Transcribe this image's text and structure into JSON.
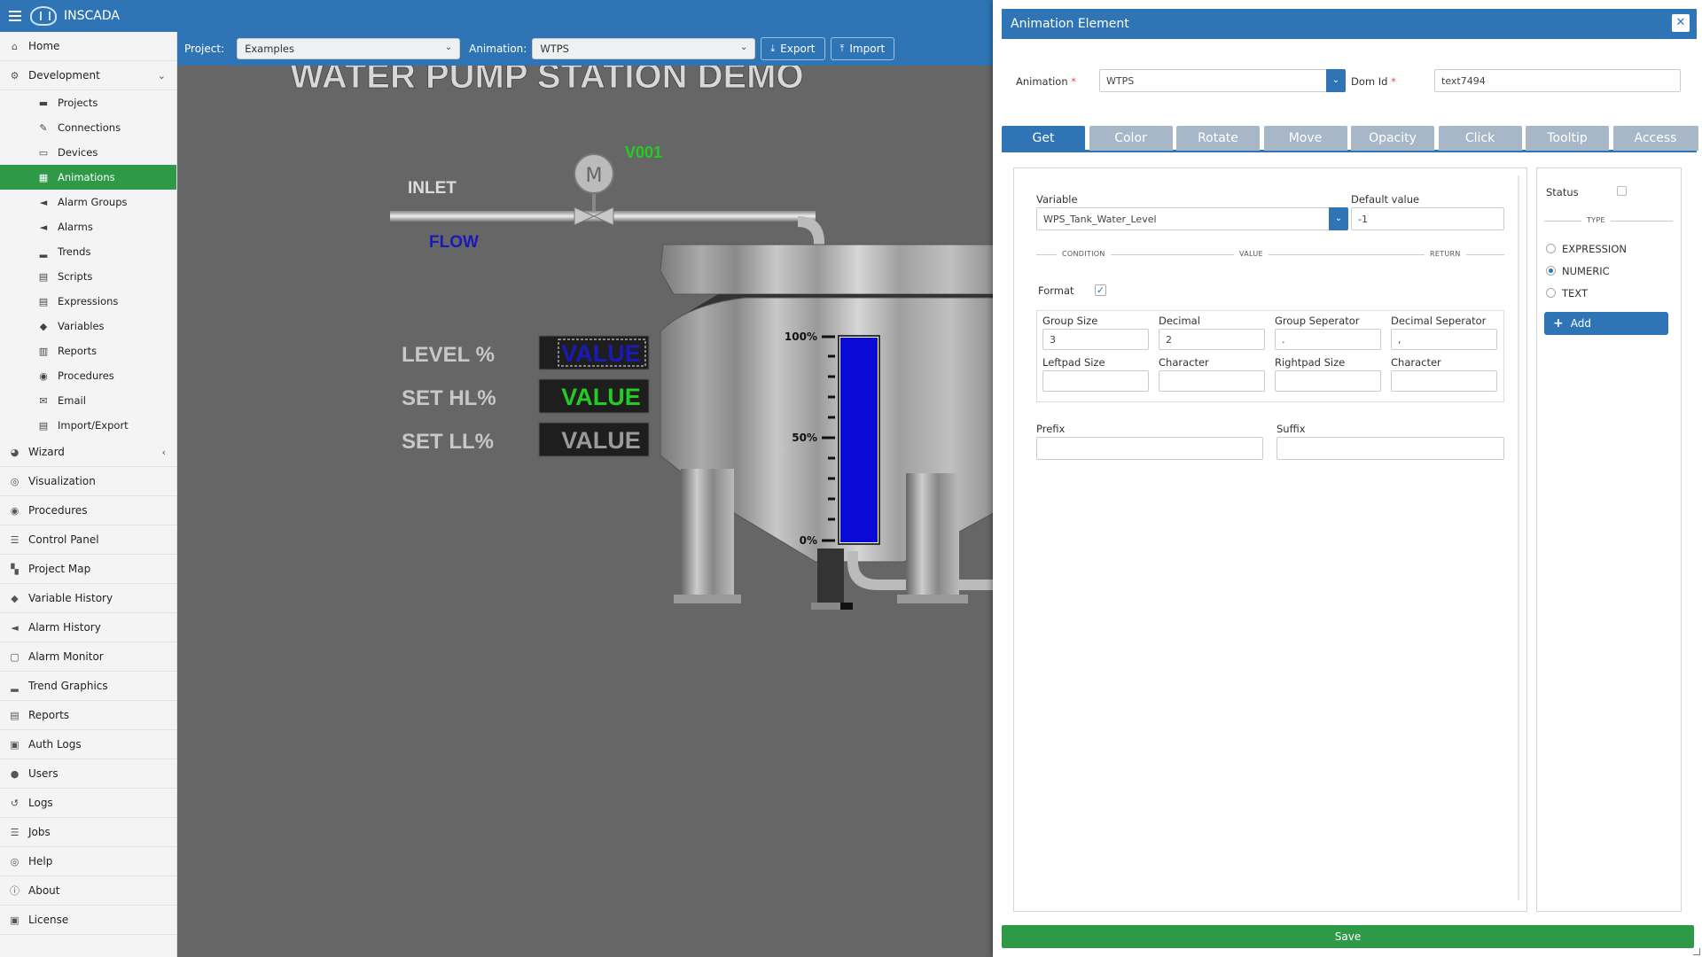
{
  "app": {
    "brand": "INSCADA"
  },
  "sidebar": {
    "items": [
      {
        "label": "Home",
        "icon": "home-icon",
        "glyph": "⌂",
        "type": "main"
      },
      {
        "label": "Development",
        "icon": "gear-icon",
        "glyph": "⚙",
        "type": "main",
        "chevron": "⌄"
      },
      {
        "label": "Projects",
        "icon": "folder-icon",
        "glyph": "▬",
        "type": "sub"
      },
      {
        "label": "Connections",
        "icon": "plug-icon",
        "glyph": "✎",
        "type": "sub"
      },
      {
        "label": "Devices",
        "icon": "monitor-icon",
        "glyph": "▭",
        "type": "sub"
      },
      {
        "label": "Animations",
        "icon": "film-icon",
        "glyph": "▦",
        "type": "sub",
        "active": true
      },
      {
        "label": "Alarm Groups",
        "icon": "bullhorn-icon",
        "glyph": "◄",
        "type": "sub"
      },
      {
        "label": "Alarms",
        "icon": "bullhorn-icon",
        "glyph": "◄",
        "type": "sub"
      },
      {
        "label": "Trends",
        "icon": "bar-signal-icon",
        "glyph": "▂",
        "type": "sub"
      },
      {
        "label": "Scripts",
        "icon": "file-icon",
        "glyph": "▤",
        "type": "sub"
      },
      {
        "label": "Expressions",
        "icon": "file-code-icon",
        "glyph": "▤",
        "type": "sub"
      },
      {
        "label": "Variables",
        "icon": "tags-icon",
        "glyph": "◆",
        "type": "sub"
      },
      {
        "label": "Reports",
        "icon": "print-icon",
        "glyph": "▥",
        "type": "sub"
      },
      {
        "label": "Procedures",
        "icon": "dot-circle-icon",
        "glyph": "◉",
        "type": "sub"
      },
      {
        "label": "Email",
        "icon": "envelope-icon",
        "glyph": "✉",
        "type": "sub"
      },
      {
        "label": "Import/Export",
        "icon": "file-icon",
        "glyph": "▤",
        "type": "sub"
      },
      {
        "label": "Wizard",
        "icon": "magic-icon",
        "glyph": "◕",
        "type": "main",
        "chevron": "‹"
      },
      {
        "label": "Visualization",
        "icon": "eye-icon",
        "glyph": "◎",
        "type": "main"
      },
      {
        "label": "Procedures",
        "icon": "dot-circle-icon",
        "glyph": "◉",
        "type": "main"
      },
      {
        "label": "Control Panel",
        "icon": "list-icon",
        "glyph": "☰",
        "type": "main"
      },
      {
        "label": "Project Map",
        "icon": "map-icon",
        "glyph": "▚",
        "type": "main"
      },
      {
        "label": "Variable History",
        "icon": "tags-icon",
        "glyph": "◆",
        "type": "main"
      },
      {
        "label": "Alarm History",
        "icon": "bullhorn-icon",
        "glyph": "◄",
        "type": "main"
      },
      {
        "label": "Alarm Monitor",
        "icon": "window-icon",
        "glyph": "▢",
        "type": "main"
      },
      {
        "label": "Trend Graphics",
        "icon": "bar-signal-icon",
        "glyph": "▂",
        "type": "main"
      },
      {
        "label": "Reports",
        "icon": "file-icon",
        "glyph": "▤",
        "type": "main"
      },
      {
        "label": "Auth Logs",
        "icon": "id-card-icon",
        "glyph": "▣",
        "type": "main"
      },
      {
        "label": "Users",
        "icon": "user-icon",
        "glyph": "●",
        "type": "main"
      },
      {
        "label": "Logs",
        "icon": "history-icon",
        "glyph": "↺",
        "type": "main"
      },
      {
        "label": "Jobs",
        "icon": "list-icon",
        "glyph": "☰",
        "type": "main"
      },
      {
        "label": "Help",
        "icon": "life-ring-icon",
        "glyph": "◎",
        "type": "main"
      },
      {
        "label": "About",
        "icon": "info-icon",
        "glyph": "ⓘ",
        "type": "main"
      },
      {
        "label": "License",
        "icon": "id-card-icon",
        "glyph": "▣",
        "type": "main"
      }
    ]
  },
  "toolbar": {
    "project_label": "Project:",
    "project_value": "Examples",
    "animation_label": "Animation:",
    "animation_value": "WTPS",
    "export_label": "Export",
    "import_label": "Import"
  },
  "scada": {
    "title": "WATER PUMP STATION DEMO",
    "valve_label": "V001",
    "inlet": "INLET",
    "flow": "FLOW",
    "motor_letter": "M",
    "rows": [
      {
        "label": "LEVEL %",
        "value": "VALUE",
        "color": "#1a1ab8"
      },
      {
        "label": "SET HL%",
        "value": "VALUE",
        "color": "#22cc22"
      },
      {
        "label": "SET LL%",
        "value": "VALUE",
        "color": "#9a9a9a"
      }
    ],
    "gauge": {
      "top": "100%",
      "mid": "50%",
      "bottom": "0%",
      "fill_fraction": 1.0,
      "fill_color": "#0a0ad6"
    }
  },
  "modal": {
    "title": "Animation Element",
    "animation_label": "Animation",
    "animation_value": "WTPS",
    "domid_label": "Dom Id",
    "domid_value": "text7494",
    "tabs": [
      "Get",
      "Color",
      "Rotate",
      "Move",
      "Opacity",
      "Click",
      "Tooltip",
      "Access"
    ],
    "variable_label": "Variable",
    "variable_value": "WPS_Tank_Water_Level",
    "default_label": "Default value",
    "default_value": "-1",
    "cond": "CONDITION",
    "value": "VALUE",
    "ret": "RETURN",
    "format_label": "Format",
    "fields": [
      {
        "label": "Group Size",
        "value": "3"
      },
      {
        "label": "Decimal",
        "value": "2"
      },
      {
        "label": "Group Seperator",
        "value": "."
      },
      {
        "label": "Decimal Seperator",
        "value": ","
      },
      {
        "label": "Leftpad Size",
        "value": ""
      },
      {
        "label": "Character",
        "value": ""
      },
      {
        "label": "Rightpad Size",
        "value": ""
      },
      {
        "label": "Character",
        "value": ""
      }
    ],
    "prefix_label": "Prefix",
    "suffix_label": "Suffix",
    "status_label": "Status",
    "type_label": "TYPE",
    "types": [
      "EXPRESSION",
      "NUMERIC",
      "TEXT"
    ],
    "selected_type": "NUMERIC",
    "add_label": "Add",
    "save_label": "Save"
  }
}
